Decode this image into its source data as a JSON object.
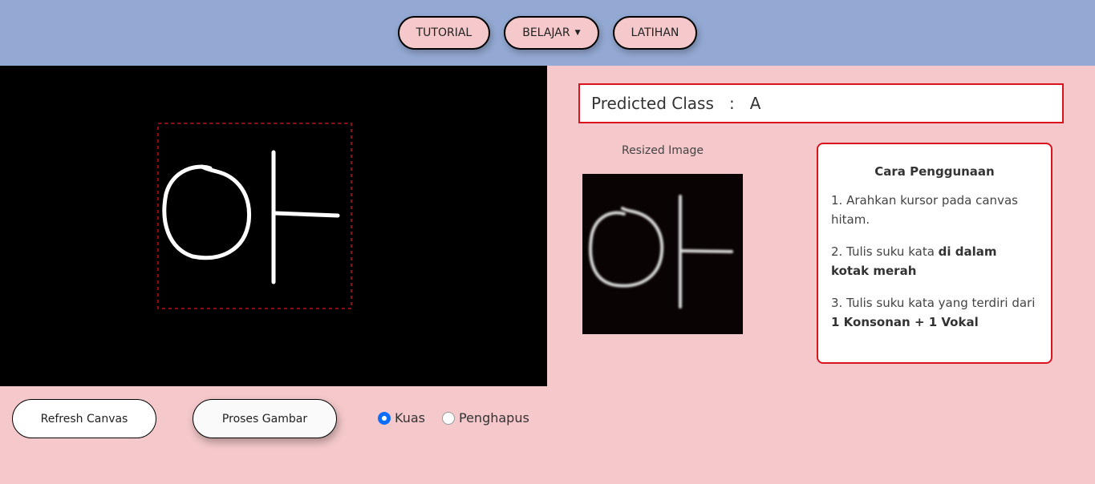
{
  "nav": {
    "tutorial": "TUTORIAL",
    "belajar": "BELAJAR",
    "latihan": "LATIHAN"
  },
  "controls": {
    "refresh_label": "Refresh Canvas",
    "proses_label": "Proses Gambar",
    "radio_kuas": "Kuas",
    "radio_penghapus": "Penghapus",
    "selected": "Kuas"
  },
  "prediction": {
    "label": "Predicted Class",
    "separator": ":",
    "value": "A"
  },
  "resized": {
    "label": "Resized Image"
  },
  "usage": {
    "title": "Cara Penggunaan",
    "step1": "1. Arahkan kursor pada canvas hitam.",
    "step2_text": "2. Tulis suku kata ",
    "step2_bold": "di dalam kotak merah",
    "step3_text": "3. Tulis suku kata yang terdiri dari ",
    "step3_bold": "1 Konsonan + 1 Vokal"
  },
  "colors": {
    "navbar": "#93a8d2",
    "background": "#f5c9cb",
    "accent_red": "#d9141c",
    "radio_blue": "#0d6efd"
  }
}
